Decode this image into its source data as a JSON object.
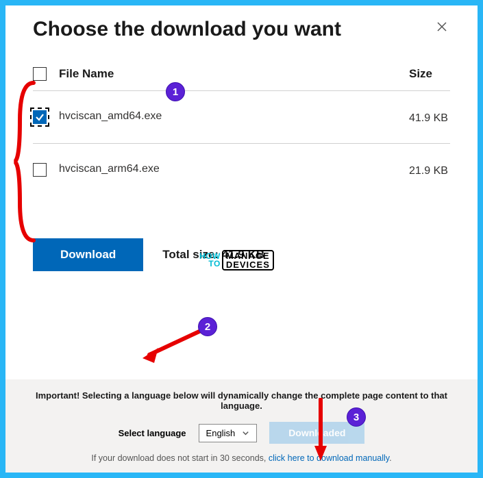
{
  "dialog": {
    "title": "Choose the download you want"
  },
  "columns": {
    "name": "File Name",
    "size": "Size"
  },
  "files": [
    {
      "name": "hvciscan_amd64.exe",
      "size": "41.9 KB",
      "checked": true
    },
    {
      "name": "hvciscan_arm64.exe",
      "size": "21.9 KB",
      "checked": false
    }
  ],
  "action": {
    "download_label": "Download",
    "total_label": "Total size: 41.9 KB"
  },
  "footer": {
    "important": "Important! Selecting a language below will dynamically change the complete page content to that language.",
    "select_label": "Select language",
    "selected_language": "English",
    "downloaded_label": "Downloaded",
    "link_prefix": "If your download does not start in 30 seconds, ",
    "link_text": "click here to download manually"
  },
  "annotations": {
    "step1": "1",
    "step2": "2",
    "step3": "3",
    "watermark_how": "HOW",
    "watermark_to": "TO",
    "watermark_manage": "MANAGE",
    "watermark_devices": "DEVICES"
  }
}
